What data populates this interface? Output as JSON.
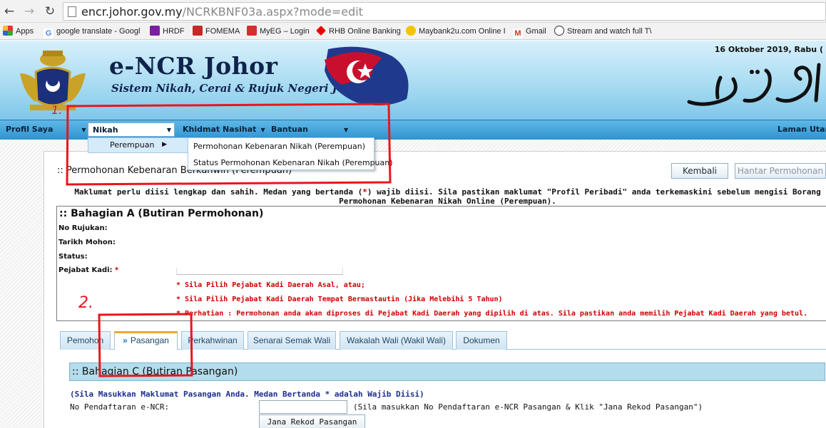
{
  "browser": {
    "url_host": "encr.johor.gov.my",
    "url_path": "/NCRKBNF03a.aspx?mode=edit",
    "bookmarks": [
      "Apps",
      "google translate - Googl",
      "HRDF",
      "FOMEMA",
      "MyEG – Login",
      "RHB Online Banking",
      "Maybank2u.com Online I",
      "Gmail",
      "Stream and watch full T\\"
    ]
  },
  "header": {
    "title": "e-NCR Johor",
    "subtitle": "Sistem Nikah, Cerai & Rujuk Negeri Johor",
    "date": "16 Oktober 2019, Rabu ("
  },
  "menu": {
    "items": [
      "Profil Saya",
      "Nikah",
      "Khidmat Nasihat",
      "Bantuan"
    ],
    "right": "Laman Utam",
    "dropdown_item": "Perempuan",
    "submenu": [
      "Permohonan Kebenaran Nikah (Perempuan)",
      "Status Permohonan Kebenaran Nikah (Perempuan)"
    ]
  },
  "page": {
    "title": ":: Permohonan Kebenaran Berkahwin (Perempuan)",
    "kembali": "Kembali",
    "hantar": "Hantar Permohonan",
    "notice_a": "Maklumat perlu diisi lengkap dan sahih. Medan yang bertanda (",
    "notice_star": "*",
    "notice_b": ") wajib diisi. Sila pastikan maklumat \"Profil Peribadi\" anda terkemaskini sebelum mengisi Borang",
    "notice_c": "Permohonan Kebenaran Nikah Online (Perempuan)."
  },
  "section_a": {
    "heading": ":: Bahagian A (Butiran Permohonan)",
    "no_rujukan": "No Rujukan:",
    "tarikh_mohon": "Tarikh Mohon:",
    "status": "Status:",
    "pejabat_kadi": "Pejabat Kadi:",
    "required_star": "*",
    "warnings": [
      "* Sila Pilih Pejabat Kadi Daerah Asal, atau;",
      "* Sila Pilih Pejabat Kadi Daerah Tempat Bermastautin (Jika Melebihi 5 Tahun)",
      "* Perhatian : Permohonan anda akan diproses di Pejabat Kadi Daerah yang dipilih di atas. Sila pastikan anda memilih Pejabat Kadi Daerah yang betul."
    ]
  },
  "tabs": [
    "Pemohon",
    "Pasangan",
    "Perkahwinan",
    "Senarai Semak Wali",
    "Wakalah Wali (Wakil Wali)",
    "Dokumen"
  ],
  "section_c": {
    "heading": ":: Bahagian C (Butiran Pasangan)",
    "hint": "(Sila Masukkan Maklumat Pasangan Anda. Medan Bertanda * adalah Wajib Diisi)",
    "reg_label": "No Pendaftaran e-NCR:",
    "reg_value": "",
    "reg_hint": "(Sila masukkan No Pendaftaran e-NCR Pasangan & Klik \"Jana Rekod Pasangan\")",
    "jana_button": "Jana Rekod Pasangan"
  },
  "annotations": {
    "marker_1": "1.",
    "marker_2": "2."
  },
  "colors": {
    "menu_blue": "#2f93d0",
    "required_red": "#cc0000",
    "annotation_red": "#e8161c",
    "tab_active_accent": "#f0a830"
  }
}
